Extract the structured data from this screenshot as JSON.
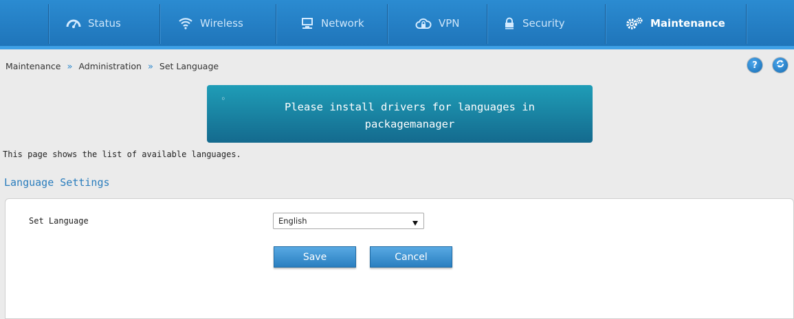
{
  "nav": {
    "tabs": [
      {
        "label": "Status",
        "icon": "dashboard-icon"
      },
      {
        "label": "Wireless",
        "icon": "wifi-icon"
      },
      {
        "label": "Network",
        "icon": "monitor-icon"
      },
      {
        "label": "VPN",
        "icon": "cloud-lock-icon"
      },
      {
        "label": "Security",
        "icon": "lock-icon"
      },
      {
        "label": "Maintenance",
        "icon": "gears-icon",
        "active": true
      }
    ]
  },
  "breadcrumb": {
    "items": [
      "Maintenance",
      "Administration",
      "Set Language"
    ],
    "separator": "»"
  },
  "help_button": {
    "glyph": "?"
  },
  "message": {
    "bullet": "◦",
    "text": "Please install drivers for languages in packagemanager"
  },
  "description": "This page shows the list of available languages.",
  "section": {
    "title": "Language Settings"
  },
  "form": {
    "set_language_label": "Set Language",
    "language_select_value": "English",
    "save_label": "Save",
    "cancel_label": "Cancel"
  },
  "colors": {
    "nav_bg": "#1e73b8",
    "accent": "#2a7dbd",
    "message_bg": "#146a8e",
    "button_bg": "#2a7fc0"
  }
}
